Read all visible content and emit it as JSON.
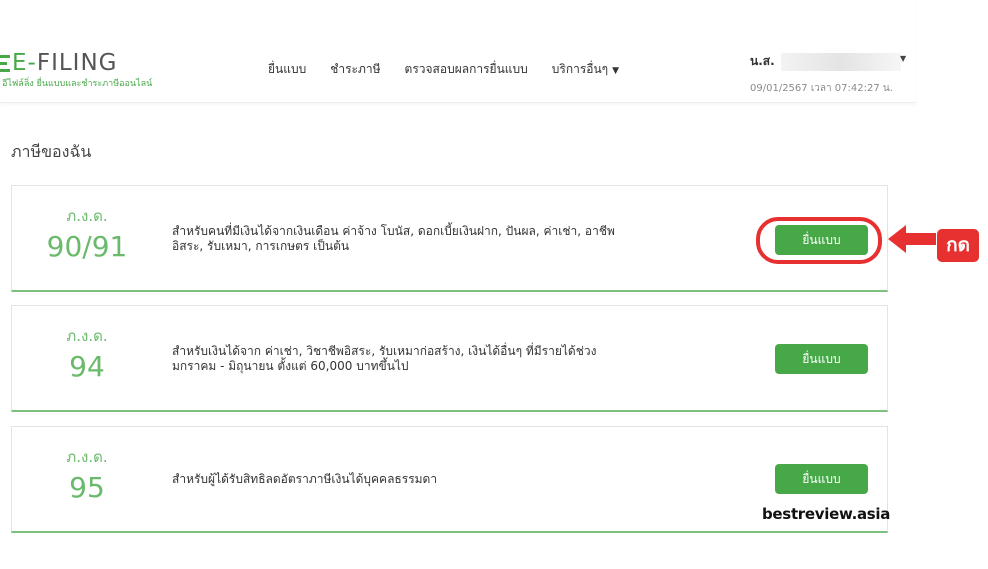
{
  "header": {
    "logo_text_dash": "E-",
    "logo_text_main": "FILING",
    "logo_subtitle": "อีไฟล์ลิ่ง ยื่นแบบและชำระภาษีออนไลน์",
    "nav": [
      {
        "label": "ยื่นแบบ"
      },
      {
        "label": "ชำระภาษี"
      },
      {
        "label": "ตรวจสอบผลการยื่นแบบ"
      },
      {
        "label": "บริการอื่นๆ"
      }
    ],
    "user_name": "น.ส.",
    "datetime": "09/01/2567 เวลา 07:42:27 น."
  },
  "page_title": "ภาษีของฉัน",
  "cards": [
    {
      "form_label": "ภ.ง.ด.",
      "form_number": "90/91",
      "desc_line1": "สำหรับคนที่มีเงินได้จากเงินเดือน ค่าจ้าง โบนัส, ดอกเบี้ยเงินฝาก, ปันผล, ค่าเช่า, อาชีพ",
      "desc_line2": "อิสระ, รับเหมา, การเกษตร เป็นต้น",
      "button_label": "ยื่นแบบ"
    },
    {
      "form_label": "ภ.ง.ด.",
      "form_number": "94",
      "desc_line1": "สำหรับเงินได้จาก ค่าเช่า, วิชาชีพอิสระ, รับเหมาก่อสร้าง, เงินได้อื่นๆ ที่มีรายได้ช่วง",
      "desc_line2": "มกราคม - มิถุนายน ตั้งแต่ 60,000 บาทขึ้นไป",
      "button_label": "ยื่นแบบ"
    },
    {
      "form_label": "ภ.ง.ด.",
      "form_number": "95",
      "desc_line1": "สำหรับผู้ได้รับสิทธิลดอัตราภาษีเงินได้บุคคลธรรมดา",
      "desc_line2": "",
      "button_label": "ยื่นแบบ"
    }
  ],
  "annotation": {
    "callout_label": "กด",
    "color": "#e73030"
  },
  "watermark": "bestreview.asia",
  "colors": {
    "accent": "#47a848",
    "code_text": "#6bba6c"
  }
}
